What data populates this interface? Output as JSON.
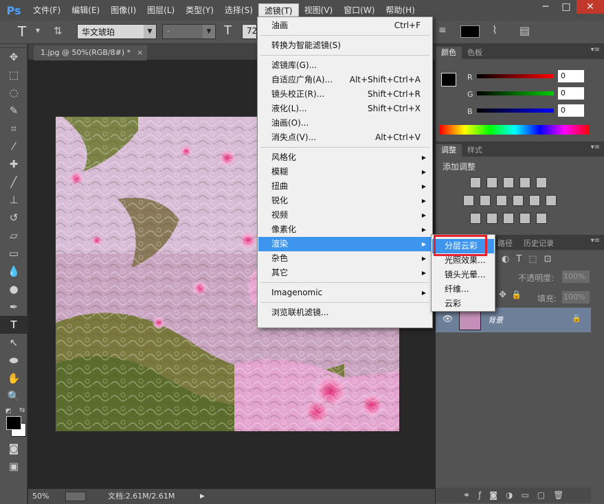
{
  "app": {
    "logo": "Ps"
  },
  "menubar": {
    "items": [
      "文件(F)",
      "编辑(E)",
      "图像(I)",
      "图层(L)",
      "类型(Y)",
      "选择(S)",
      "滤镜(T)",
      "视图(V)",
      "窗口(W)",
      "帮助(H)"
    ],
    "active": "滤镜(T)"
  },
  "window_controls": {
    "minimize": "─",
    "maximize": "□",
    "close": "✕"
  },
  "options": {
    "tool_glyph": "T",
    "font_family": "华文琥珀",
    "font_style": "-",
    "font_size": "72"
  },
  "document": {
    "tab_title": "1.jpg @ 50%(RGB/8#) *",
    "zoom": "50%",
    "doc_info": "文档:2.61M/2.61M"
  },
  "filter_menu": {
    "items": [
      {
        "label": "油画",
        "shortcut": "Ctrl+F"
      },
      {
        "sep": true
      },
      {
        "label": "转换为智能滤镜(S)"
      },
      {
        "sep": true
      },
      {
        "label": "滤镜库(G)..."
      },
      {
        "label": "自适应广角(A)...",
        "shortcut": "Alt+Shift+Ctrl+A"
      },
      {
        "label": "镜头校正(R)...",
        "shortcut": "Shift+Ctrl+R"
      },
      {
        "label": "液化(L)...",
        "shortcut": "Shift+Ctrl+X"
      },
      {
        "label": "油画(O)..."
      },
      {
        "label": "消失点(V)...",
        "shortcut": "Alt+Ctrl+V"
      },
      {
        "sep": true
      },
      {
        "label": "风格化",
        "submenu": true
      },
      {
        "label": "模糊",
        "submenu": true
      },
      {
        "label": "扭曲",
        "submenu": true
      },
      {
        "label": "锐化",
        "submenu": true
      },
      {
        "label": "视频",
        "submenu": true
      },
      {
        "label": "像素化",
        "submenu": true
      },
      {
        "label": "渲染",
        "submenu": true,
        "highlighted": true
      },
      {
        "label": "杂色",
        "submenu": true
      },
      {
        "label": "其它",
        "submenu": true
      },
      {
        "sep": true
      },
      {
        "label": "Imagenomic",
        "submenu": true
      },
      {
        "sep": true
      },
      {
        "label": "浏览联机滤镜..."
      }
    ]
  },
  "render_submenu": {
    "items": [
      "分层云彩",
      "光照效果...",
      "镜头光晕...",
      "纤维...",
      "云彩"
    ],
    "highlighted": "分层云彩"
  },
  "color_panel": {
    "tabs": [
      "颜色",
      "色板"
    ],
    "channels": [
      {
        "label": "R",
        "value": "0"
      },
      {
        "label": "G",
        "value": "0"
      },
      {
        "label": "B",
        "value": "0"
      }
    ]
  },
  "adjustments_panel": {
    "tabs": [
      "调整",
      "样式"
    ],
    "title": "添加调整"
  },
  "layers_panel": {
    "tabs": [
      "路径",
      "历史记录"
    ],
    "opacity_label": "不透明度:",
    "opacity_value": "100%",
    "fill_label": "填充:",
    "fill_value": "100%",
    "layer_name": "背景"
  },
  "colors": {
    "accent": "#3d95ee",
    "highlight_box": "#e8212e"
  }
}
